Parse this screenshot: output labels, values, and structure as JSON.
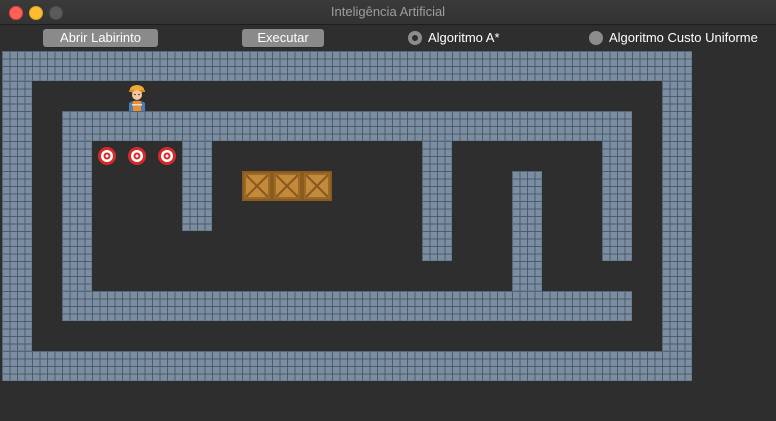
{
  "window": {
    "title": "Inteligência Artificial"
  },
  "toolbar": {
    "open_label": "Abrir Labirinto",
    "run_label": "Executar"
  },
  "algorithms": {
    "options": [
      {
        "label": "Algoritmo A*",
        "selected": true
      },
      {
        "label": "Algoritmo Custo Uniforme",
        "selected": false
      }
    ]
  },
  "maze": {
    "wall_color": "#7b8ea1",
    "floor_color": "#2e2e2e",
    "targets_count": 3,
    "crates_count": 3,
    "icons": {
      "player": "worker-icon",
      "target": "target-icon",
      "crate": "crate-icon"
    }
  }
}
